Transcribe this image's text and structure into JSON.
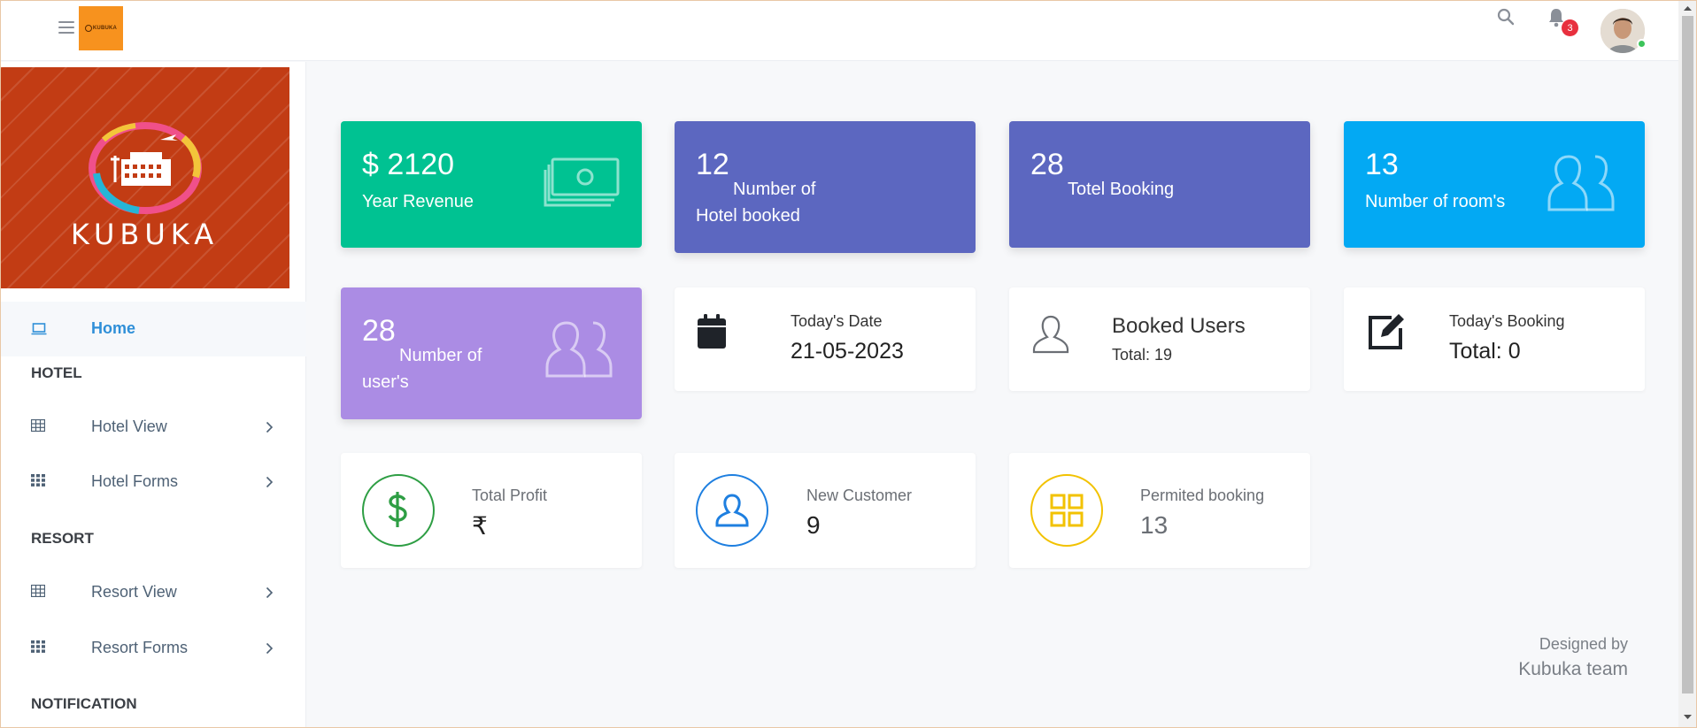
{
  "topbar": {
    "logo_text": "KUBUKA",
    "notification_count": "3"
  },
  "sidebar": {
    "hero_title": "KUBUKA",
    "home": "Home",
    "sections": [
      "HOTEL",
      "RESORT",
      "NOTIFICATION"
    ],
    "items": [
      {
        "label": "Hotel View",
        "icon": "table-icon"
      },
      {
        "label": "Hotel Forms",
        "icon": "grid-icon"
      },
      {
        "label": "Resort View",
        "icon": "table-icon"
      },
      {
        "label": "Resort Forms",
        "icon": "grid-icon"
      }
    ]
  },
  "cards": {
    "revenue": {
      "currency": "$",
      "value": "2120",
      "label": "Year Revenue",
      "color": "#00c292",
      "icon": "money-icon"
    },
    "hotels": {
      "value": "12",
      "label_line1": "Number of",
      "label_line2": "Hotel booked",
      "color": "#5c67c0"
    },
    "bookings": {
      "value": "28",
      "label": "Totel Booking",
      "color": "#5c67c0"
    },
    "rooms": {
      "value": "13",
      "label": "Number of room's",
      "color": "#03a9f3",
      "icon": "users-icon"
    },
    "users": {
      "value": "28",
      "label_line1": "Number of",
      "label_line2": "user's",
      "color": "#ab8ce4",
      "icon": "users-icon"
    },
    "date": {
      "title": "Today's Date",
      "value": "21-05-2023",
      "icon": "calendar-icon"
    },
    "booked_users": {
      "title": "Booked Users",
      "total": "Total: 19",
      "icon": "user-icon"
    },
    "todays_booking": {
      "title": "Today's Booking",
      "total": "Total: 0",
      "icon": "edit-icon"
    },
    "profit": {
      "title": "Total Profit",
      "value": "₹",
      "icon": "dollar-icon",
      "color": "#2e9e44"
    },
    "customer": {
      "title": "New Customer",
      "value": "9",
      "icon": "user-icon",
      "color": "#1e7fe0"
    },
    "permitted": {
      "title": "Permited booking",
      "value": "13",
      "icon": "grid-icon",
      "color": "#f2c200"
    }
  },
  "footer": {
    "line1": "Designed by",
    "line2": "Kubuka team"
  }
}
